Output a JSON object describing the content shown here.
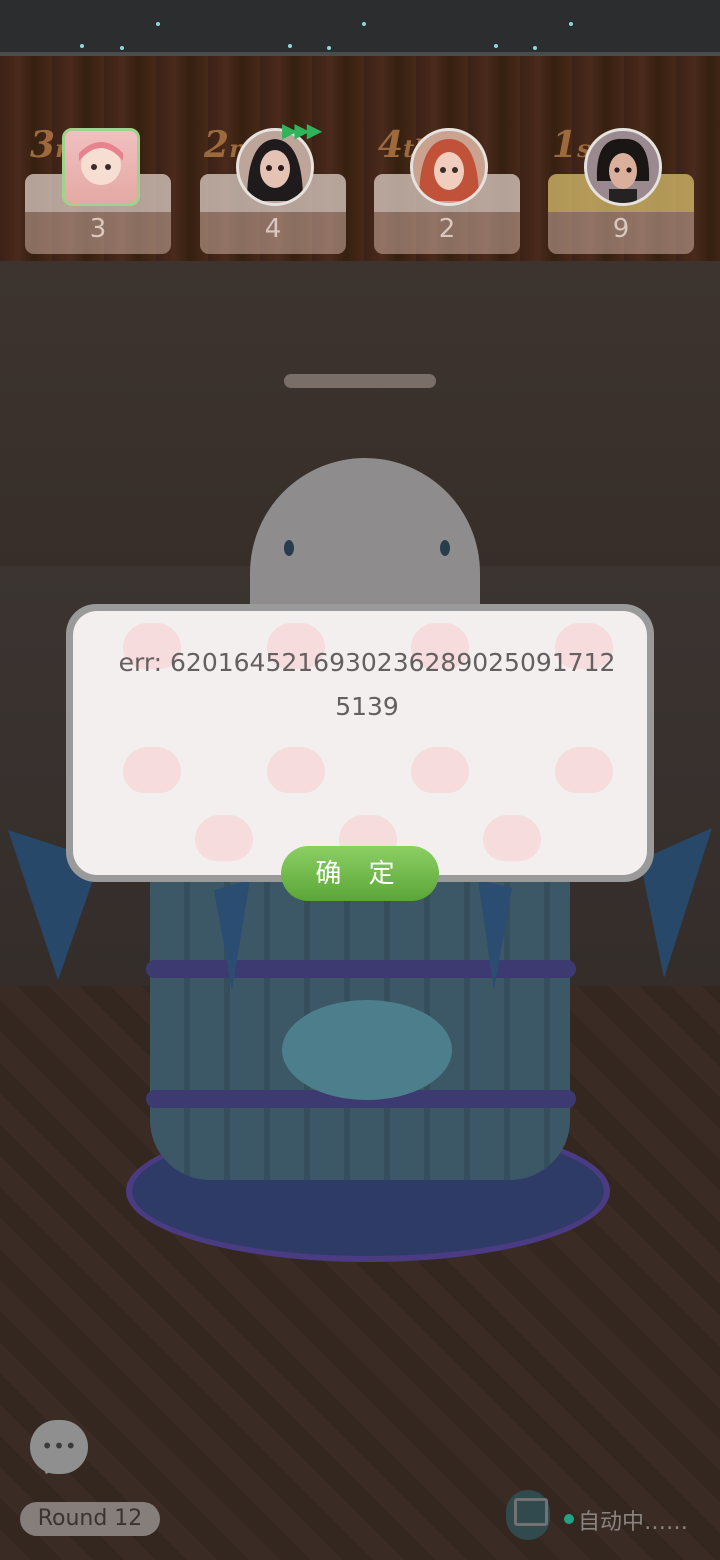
{
  "scoreboard": {
    "players": [
      {
        "rank_num": "3",
        "rank_suffix": "rd",
        "score": "3"
      },
      {
        "rank_num": "2",
        "rank_suffix": "nd",
        "score": "4"
      },
      {
        "rank_num": "4",
        "rank_suffix": "th",
        "score": "2"
      },
      {
        "rank_num": "1",
        "rank_suffix": "st",
        "score": "9"
      }
    ],
    "turn_indicator": "▶▶▶"
  },
  "dialog": {
    "message": "err: 62016452169302362890250917125139",
    "confirm_label": "确 定"
  },
  "hud": {
    "round_label": "Round  12",
    "auto_status": "自动中……",
    "chat_icon": "•••"
  },
  "colors": {
    "confirm_button": "#6cb845",
    "rank_text": "#9c6a3c",
    "auto_dot": "#22a287"
  }
}
